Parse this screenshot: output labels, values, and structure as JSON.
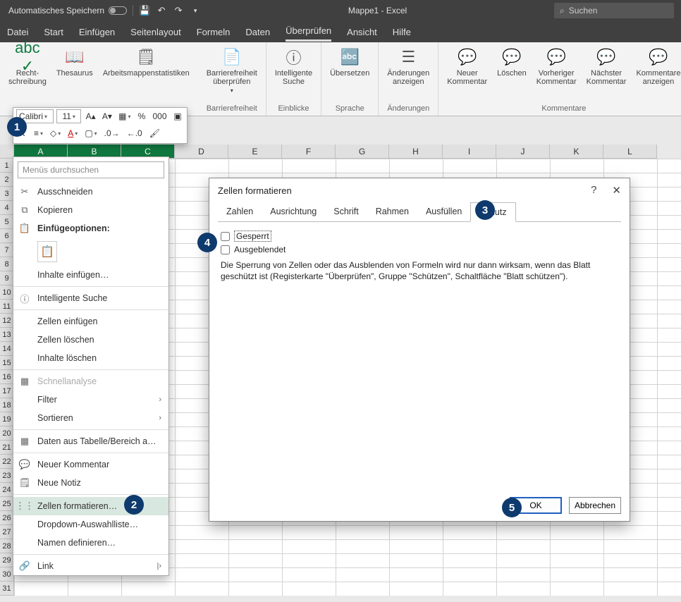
{
  "titlebar": {
    "autosave": "Automatisches Speichern",
    "title": "Mappe1  -  Excel",
    "search_placeholder": "Suchen"
  },
  "ribbon_tabs": [
    "Datei",
    "Start",
    "Einfügen",
    "Seitenlayout",
    "Formeln",
    "Daten",
    "Überprüfen",
    "Ansicht",
    "Hilfe"
  ],
  "active_tab": "Überprüfen",
  "ribbon": {
    "spellcheck": "Recht-\nschreibung",
    "thesaurus": "Thesaurus",
    "workbookstats": "Arbeitsmappenstatistiken",
    "accessibility_btn": "Barrierefreiheit\nüberprüfen",
    "accessibility_grp": "Barrierefreiheit",
    "smartlookup": "Intelligente\nSuche",
    "insights_grp": "Einblicke",
    "translate": "Übersetzen",
    "language_grp": "Sprache",
    "showchanges": "Änderungen\nanzeigen",
    "changes_grp": "Änderungen",
    "newcomment": "Neuer\nKommentar",
    "delete": "Löschen",
    "prevcomment": "Vorheriger\nKommentar",
    "nextcomment": "Nächster\nKommentar",
    "showcomments": "Kommentare\nanzeigen",
    "comments_grp": "Kommentare"
  },
  "minibar": {
    "font": "Calibri",
    "size": "11"
  },
  "columns": [
    "A",
    "B",
    "C",
    "D",
    "E",
    "F",
    "G",
    "H",
    "I",
    "J",
    "K",
    "L"
  ],
  "rows": [
    "1",
    "2",
    "3",
    "4",
    "5",
    "6",
    "7",
    "8",
    "9",
    "10",
    "11",
    "12",
    "13",
    "14",
    "15",
    "16",
    "17",
    "18",
    "19",
    "20",
    "21",
    "22",
    "23",
    "24",
    "25",
    "26",
    "27",
    "28",
    "29",
    "30",
    "31"
  ],
  "context_menu": {
    "search": "Menüs durchsuchen",
    "cut": "Ausschneiden",
    "copy": "Kopieren",
    "paste_options": "Einfügeoptionen:",
    "paste_special": "Inhalte einfügen…",
    "smart_lookup": "Intelligente Suche",
    "insert_cells": "Zellen einfügen",
    "delete_cells": "Zellen löschen",
    "clear_contents": "Inhalte löschen",
    "quick_analysis": "Schnellanalyse",
    "filter": "Filter",
    "sort": "Sortieren",
    "from_table": "Daten aus Tabelle/Bereich a…",
    "new_comment": "Neuer Kommentar",
    "new_note": "Neue Notiz",
    "format_cells": "Zellen formatieren…",
    "dropdown_list": "Dropdown-Auswahlliste…",
    "define_name": "Namen definieren…",
    "link": "Link"
  },
  "dialog": {
    "title": "Zellen formatieren",
    "tabs": [
      "Zahlen",
      "Ausrichtung",
      "Schrift",
      "Rahmen",
      "Ausfüllen",
      "Schutz"
    ],
    "active_tab": "Schutz",
    "chk_locked": "Gesperrt",
    "chk_hidden": "Ausgeblendet",
    "description": "Die Sperrung von Zellen oder das Ausblenden von Formeln wird nur dann wirksam, wenn das Blatt geschützt ist (Registerkarte \"Überprüfen\", Gruppe \"Schützen\", Schaltfläche \"Blatt schützen\").",
    "ok": "OK",
    "cancel": "Abbrechen"
  },
  "badges": {
    "b1": "1",
    "b2": "2",
    "b3": "3",
    "b4": "4",
    "b5": "5"
  }
}
